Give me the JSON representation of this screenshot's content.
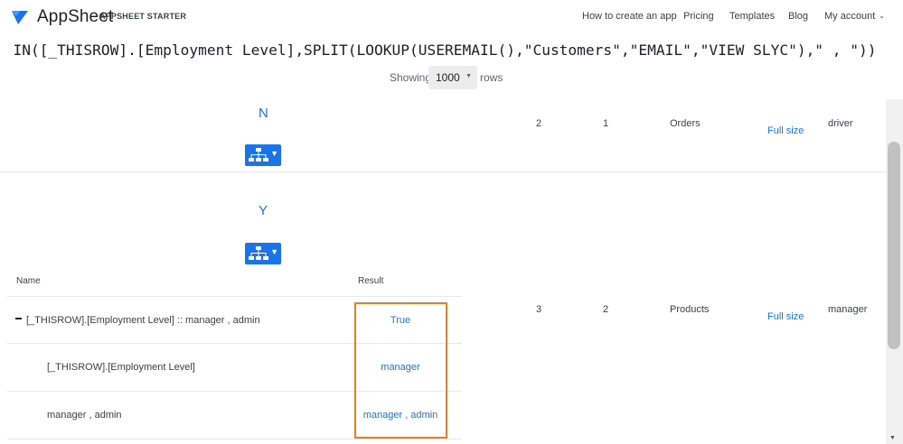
{
  "brand": {
    "name": "AppSheet",
    "plan": "APPSHEET STARTER",
    "logo_icon": "appsheet-logo-icon"
  },
  "nav": {
    "items": [
      "How to create an app",
      "Pricing",
      "Templates",
      "Blog",
      "My account"
    ],
    "account_caret": "⌄"
  },
  "expression": "IN([_THISROW].[Employment Level],SPLIT(LOOKUP(USEREMAIL(),\"Customers\",\"EMAIL\",\"VIEW SLYC\"),\" , \"))",
  "pager": {
    "showing_label": "Showing",
    "rows_value": "1000",
    "rows_label": "rows"
  },
  "rows": [
    {
      "flag": "N",
      "col1": "2",
      "col2": "1",
      "table": "Orders",
      "link": "Full size",
      "role": "driver"
    },
    {
      "flag": "Y",
      "col1": "3",
      "col2": "2",
      "table": "Products",
      "link": "Full size",
      "role": "manager"
    }
  ],
  "eval_table": {
    "headers": {
      "name": "Name",
      "result": "Result"
    },
    "rows": [
      {
        "name": "[_THISROW].[Employment Level] :: manager , admin",
        "result": "True"
      },
      {
        "name": "[_THISROW].[Employment Level]",
        "result": "manager"
      },
      {
        "name": "manager , admin",
        "result": "manager , admin"
      }
    ]
  },
  "colors": {
    "accent": "#1a73e8",
    "highlight": "#f07c1f"
  }
}
